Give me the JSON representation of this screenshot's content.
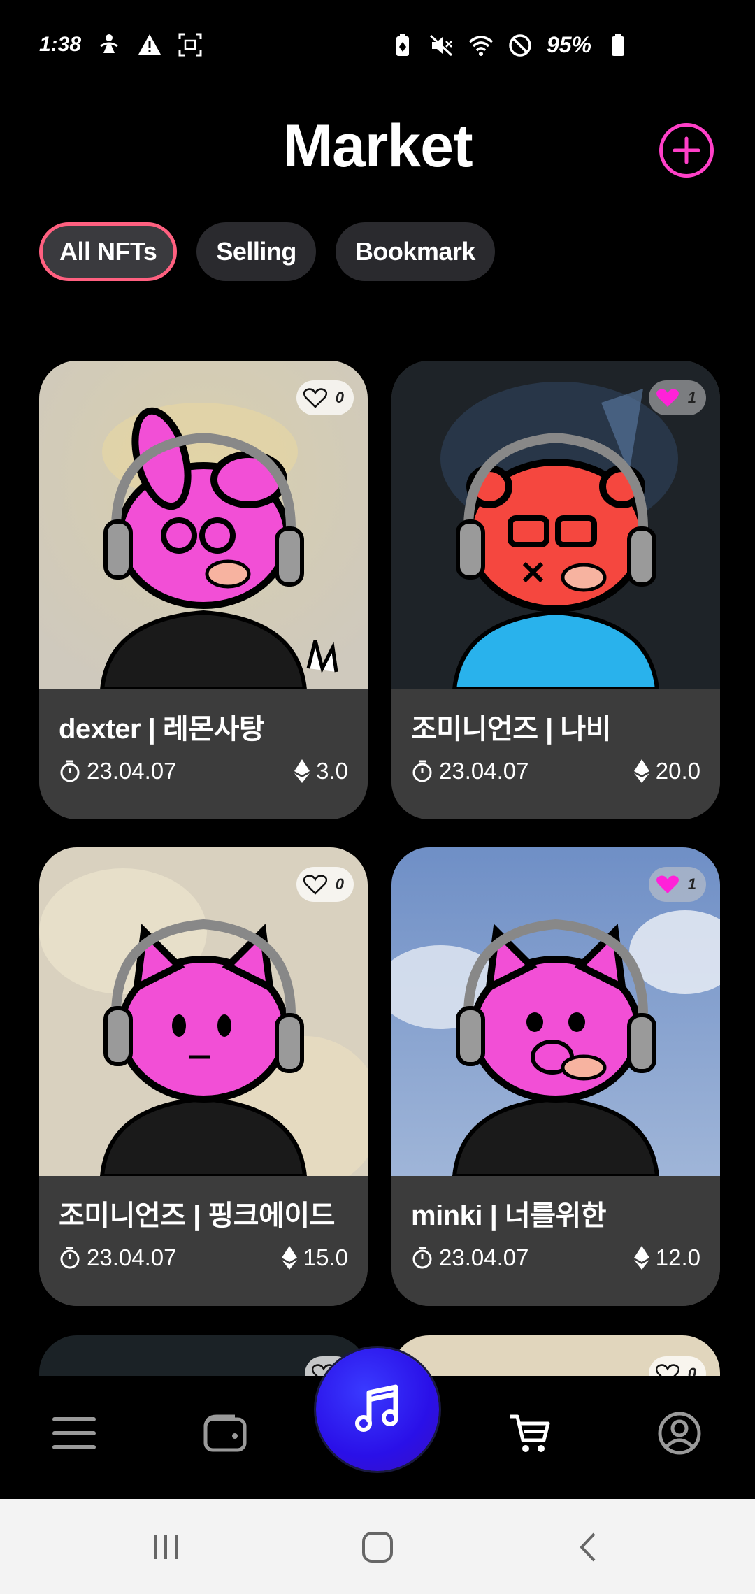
{
  "status_bar": {
    "time": "1:38",
    "battery_percent": "95%",
    "icons_left": [
      "accessibility-icon",
      "warning-icon",
      "screenshot-icon"
    ],
    "icons_right": [
      "battery-saver-icon",
      "mute-icon",
      "wifi-icon",
      "do-not-disturb-icon",
      "battery-icon"
    ]
  },
  "header": {
    "title": "Market",
    "add_icon": "plus-circle-icon",
    "accent_color": "#ff40c8"
  },
  "tabs": [
    {
      "label": "All NFTs",
      "active": true
    },
    {
      "label": "Selling",
      "active": false
    },
    {
      "label": "Bookmark",
      "active": false
    }
  ],
  "cards": [
    {
      "name": "dexter | 레몬사탕",
      "date": "23.04.07",
      "price": "3.0",
      "likes": "0",
      "liked": false
    },
    {
      "name": "조미니언즈 | 나비",
      "date": "23.04.07",
      "price": "20.0",
      "likes": "1",
      "liked": true
    },
    {
      "name": "조미니언즈 | 핑크에이드",
      "date": "23.04.07",
      "price": "15.0",
      "likes": "0",
      "liked": false
    },
    {
      "name": "minki | 너를위한",
      "date": "23.04.07",
      "price": "12.0",
      "likes": "1",
      "liked": true
    }
  ],
  "partial_cards": [
    {
      "likes": ""
    },
    {
      "likes": "0"
    }
  ],
  "bottom_nav": {
    "items": [
      "menu-icon",
      "wallet-icon",
      "music-icon",
      "cart-icon",
      "profile-icon"
    ],
    "active": "cart-icon",
    "fab_color": "#2a10e8"
  },
  "system_nav": [
    "recents-icon",
    "home-icon",
    "back-icon"
  ]
}
